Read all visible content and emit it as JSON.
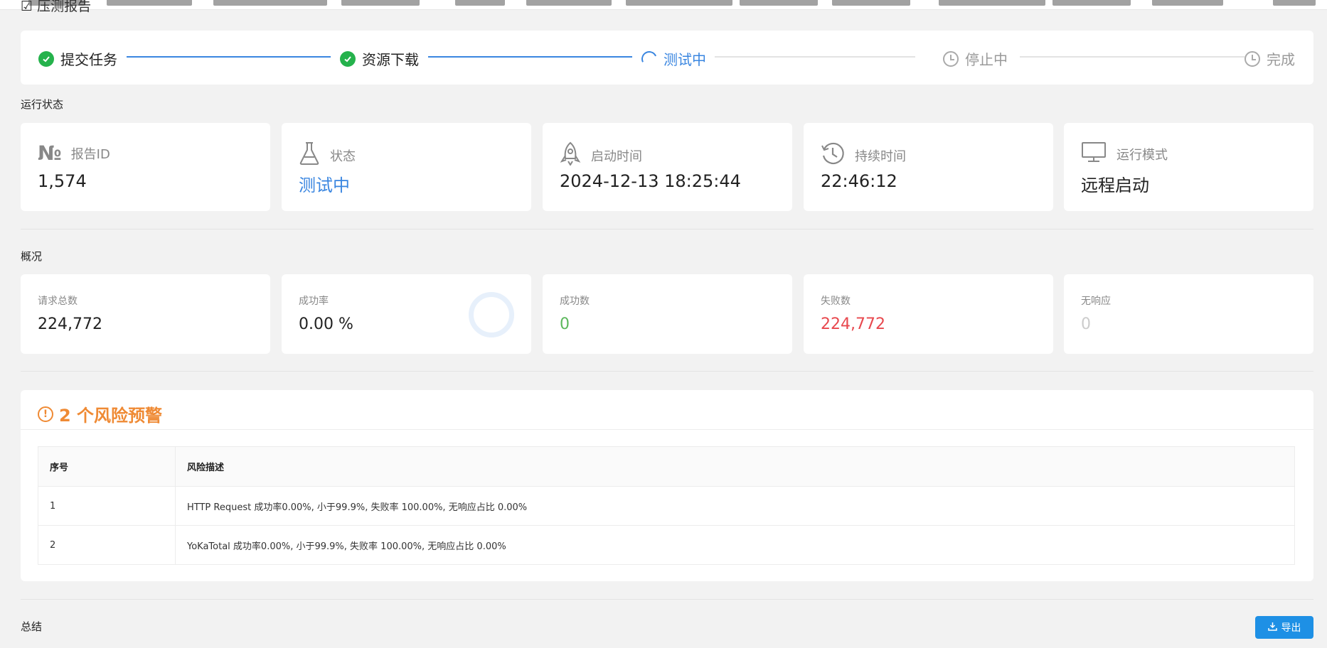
{
  "page": {
    "title": "压测报告"
  },
  "steps": [
    {
      "label": "提交任务",
      "state": "done",
      "icon": "check-circle-icon"
    },
    {
      "label": "资源下载",
      "state": "done",
      "icon": "check-circle-icon"
    },
    {
      "label": "测试中",
      "state": "active",
      "icon": "loading-icon"
    },
    {
      "label": "停止中",
      "state": "wait",
      "icon": "clock-icon"
    },
    {
      "label": "完成",
      "state": "wait",
      "icon": "clock-icon"
    }
  ],
  "run_state": {
    "title": "运行状态",
    "cards": [
      {
        "label": "报告ID",
        "value": "1,574",
        "icon": "number-icon"
      },
      {
        "label": "状态",
        "value": "测试中",
        "icon": "flask-icon"
      },
      {
        "label": "启动时间",
        "value": "2024-12-13 18:25:44",
        "icon": "rocket-icon"
      },
      {
        "label": "持续时间",
        "value": "22:46:12",
        "icon": "history-clock-icon"
      },
      {
        "label": "运行模式",
        "value": "远程启动",
        "icon": "monitor-icon"
      }
    ]
  },
  "overview": {
    "title": "概况",
    "cards": [
      {
        "label": "请求总数",
        "value": "224,772"
      },
      {
        "label": "成功率",
        "value": "0.00 %",
        "progress": 0
      },
      {
        "label": "成功数",
        "value": "0"
      },
      {
        "label": "失败数",
        "value": "224,772"
      },
      {
        "label": "无响应",
        "value": "0"
      }
    ]
  },
  "risk": {
    "title": "2 个风险预警",
    "columns": [
      "序号",
      "风险描述"
    ],
    "rows": [
      {
        "no": "1",
        "desc": "HTTP Request 成功率0.00%, 小于99.9%, 失败率 100.00%, 无响应占比 0.00%"
      },
      {
        "no": "2",
        "desc": "YoKaTotal 成功率0.00%, 小于99.9%, 失败率 100.00%, 无响应占比 0.00%"
      }
    ]
  },
  "summary": {
    "title": "总结",
    "export_label": "导出"
  },
  "colors": {
    "accent": "#3a86e0",
    "success": "#25b24c",
    "warning": "#ef8a34",
    "danger": "#e8484e",
    "button": "#1e90e5"
  }
}
